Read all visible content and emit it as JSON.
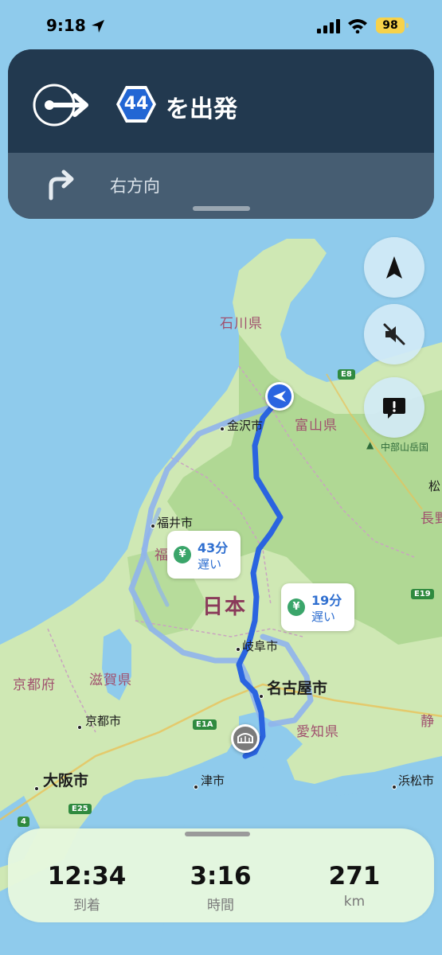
{
  "status_bar": {
    "time": "9:18",
    "battery": "98"
  },
  "banner": {
    "route_number": "44",
    "instruction": "を出発",
    "next_instruction": "右方向"
  },
  "map": {
    "prefectures": [
      "石川県",
      "富山県",
      "福",
      "京都府",
      "滋賀県",
      "愛知県",
      "長野",
      "静",
      "日本"
    ],
    "cities": [
      "金沢市",
      "福井市",
      "岐阜市",
      "名古屋市",
      "京都市",
      "大阪市",
      "津市",
      "浜松市",
      "松"
    ],
    "poi": "中部山岳国",
    "highway_shields": [
      "E8",
      "E19",
      "E1A",
      "E25",
      "4"
    ]
  },
  "callouts": [
    {
      "time": "43分",
      "note": "遅い",
      "icon": "yen-icon"
    },
    {
      "time": "19分",
      "note": "遅い",
      "icon": "yen-icon"
    }
  ],
  "trip": {
    "arrival": {
      "value": "12:34",
      "label": "到着"
    },
    "duration": {
      "value": "3:16",
      "label": "時間"
    },
    "distance": {
      "value": "271",
      "label": "km"
    }
  },
  "colors": {
    "route_active": "#2a64e0",
    "route_alt": "#8fb4ec",
    "banner_dark": "#22394f",
    "sheet_bg": "#e6f8de"
  }
}
